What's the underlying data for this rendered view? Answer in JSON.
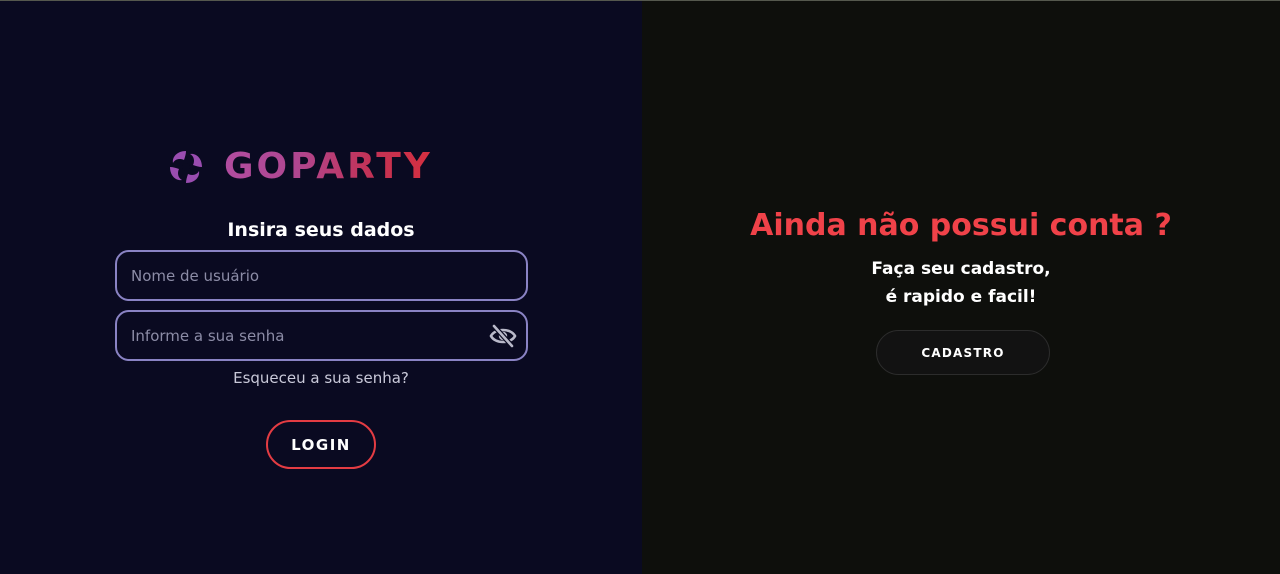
{
  "brand": {
    "name": "GOPARTY"
  },
  "login": {
    "title": "Insira seus dados",
    "username": {
      "placeholder": "Nome de usuário",
      "value": ""
    },
    "password": {
      "placeholder": "Informe a sua senha",
      "value": ""
    },
    "forgot_label": "Esqueceu a sua senha?",
    "login_label": "LOGIN"
  },
  "signup": {
    "title": "Ainda não possui conta ?",
    "line1": "Faça seu cadastro,",
    "line2": "é rapido e facil!",
    "button_label": "CADASTRO"
  },
  "colors": {
    "left_bg": "#0a0a21",
    "right_bg": "#0e0f0c",
    "accent_red": "#f04249",
    "field_border": "#8a83c4",
    "logo_purple": "#9a4db0"
  },
  "icons": {
    "logo": "swirl-logo-icon",
    "password_toggle": "eye-slash-icon"
  }
}
